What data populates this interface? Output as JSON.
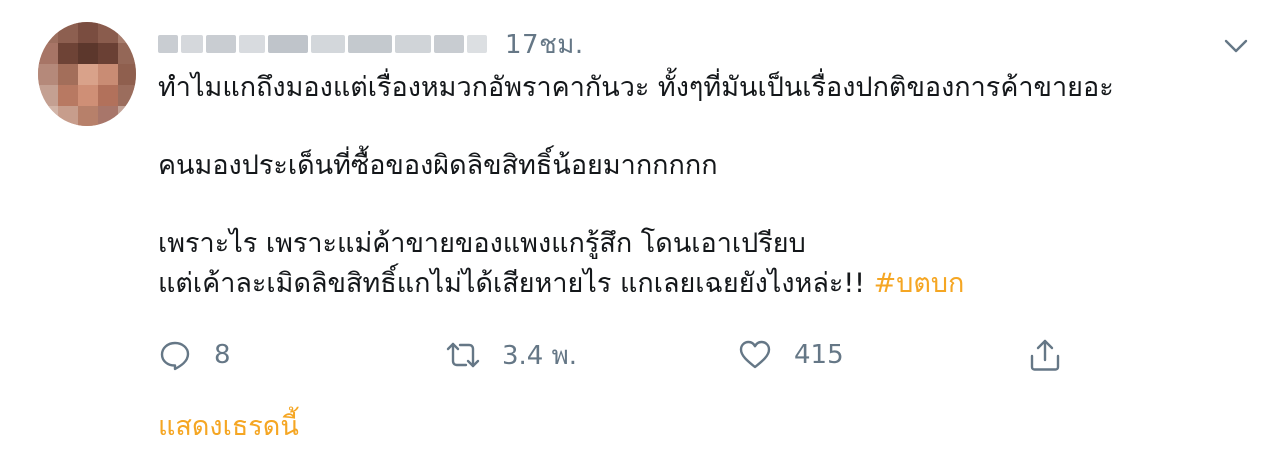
{
  "tweet": {
    "time": "17ชม.",
    "lines": [
      "ทำไมแกถึงมองแต่เรื่องหมวกอัพราคากันวะ ทั้งๆที่มันเป็นเรื่องปกติของการค้าขายอะ",
      "คนมองประเด็นที่ซื้อของผิดลิขสิทธิ์น้อยมากกกกก",
      "เพราะไร เพราะแม่ค้าขายของแพงแกรู้สึก โดนเอาเปรียบ",
      "แต่เค้าละเมิดลิขสิทธิ์แกไม่ได้เสียหายไร แกเลยเฉยยังไงหล่ะ!! "
    ],
    "hashtag": "#บตบก",
    "reply_count": "8",
    "retweet_count": "3.4 พ.",
    "like_count": "415",
    "show_thread": "แสดงเธรดนี้",
    "accent_color": "#f5a623",
    "icons": {
      "more": "chevron-down-icon",
      "reply": "reply-bubble-icon",
      "retweet": "retweet-icon",
      "like": "heart-icon",
      "share": "share-icon"
    }
  }
}
